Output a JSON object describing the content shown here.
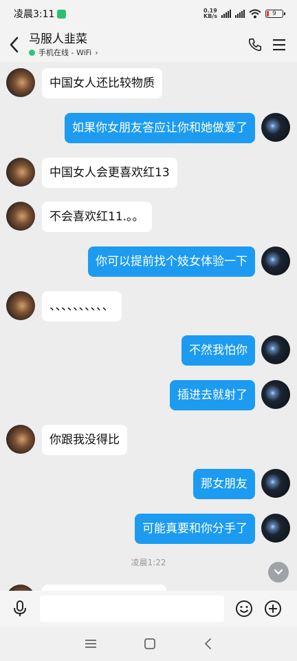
{
  "status_bar": {
    "time": "凌晨3:11",
    "net_speed_value": "0.19",
    "net_speed_unit": "KB/s",
    "battery": "9"
  },
  "header": {
    "title": "马服人韭菜",
    "status": "手机在线 - WiFi",
    "status_chevron": "›"
  },
  "messages": [
    {
      "side": "left",
      "text": "中国女人还比较物质"
    },
    {
      "side": "right",
      "text": "如果你女朋友答应让你和她做爱了"
    },
    {
      "side": "left",
      "text": "中国女人会更喜欢红13"
    },
    {
      "side": "left",
      "text": "不会喜欢红11.。。"
    },
    {
      "side": "right",
      "text": "你可以提前找个妓女体验一下"
    },
    {
      "side": "left",
      "text": "、、、、、、、、、、"
    },
    {
      "side": "right",
      "text": "不然我怕你"
    },
    {
      "side": "right",
      "text": "插进去就射了"
    },
    {
      "side": "left",
      "text": "你跟我没得比"
    },
    {
      "side": "right",
      "text": "那女朋友"
    },
    {
      "side": "right",
      "text": "可能真要和你分手了"
    }
  ],
  "timestamp": "凌晨1:22",
  "input": {
    "value": "",
    "placeholder": ""
  },
  "icons": {
    "back": "back-arrow-icon",
    "call": "phone-icon",
    "menu": "menu-icon",
    "mic": "microphone-icon",
    "emoji": "emoji-icon",
    "add": "plus-icon",
    "scroll": "chevron-down-icon"
  },
  "colors": {
    "outgoing_bubble": "#1c9bf0",
    "incoming_bubble": "#ffffff",
    "background": "#ededed",
    "online": "#2ec27e"
  }
}
